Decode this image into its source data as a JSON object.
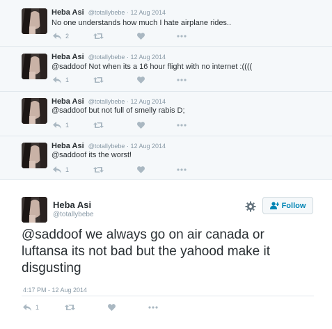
{
  "user": {
    "name": "Heba Asi",
    "handle": "@totallybebe",
    "handle_short": "@totallybebe"
  },
  "conversation": [
    {
      "date": "12 Aug 2014",
      "text": "No one understands how much I hate airplane rides..",
      "replies": "2"
    },
    {
      "date": "12 Aug 2014",
      "text": "@saddoof Not when its a 16 hour flight with no internet :((((",
      "replies": "1"
    },
    {
      "date": "12 Aug 2014",
      "text": "@saddoof but not full of smelly rabis D;",
      "replies": "1"
    },
    {
      "date": "12 Aug 2014",
      "text": "@saddoof its the worst!",
      "replies": "1"
    }
  ],
  "main_tweet": {
    "text": "@saddoof we always go on air canada or luftansa its not bad but the yahood make it disgusting",
    "timestamp": "4:17 PM - 12 Aug 2014",
    "replies": "1"
  },
  "follow_button": {
    "label": "Follow"
  },
  "separator": "·",
  "icons": {
    "reply": "reply-icon",
    "retweet": "retweet-icon",
    "like": "heart-icon",
    "more": "more-icon",
    "settings": "gear-icon",
    "follow": "add-user-icon"
  },
  "colors": {
    "background": "#ffffff",
    "conversation_bg": "#f5f8fa",
    "text": "#292f33",
    "muted": "#8899a6",
    "icon": "#aab8c2",
    "link_blue": "#0084b4",
    "divider": "#e1e8ed"
  }
}
